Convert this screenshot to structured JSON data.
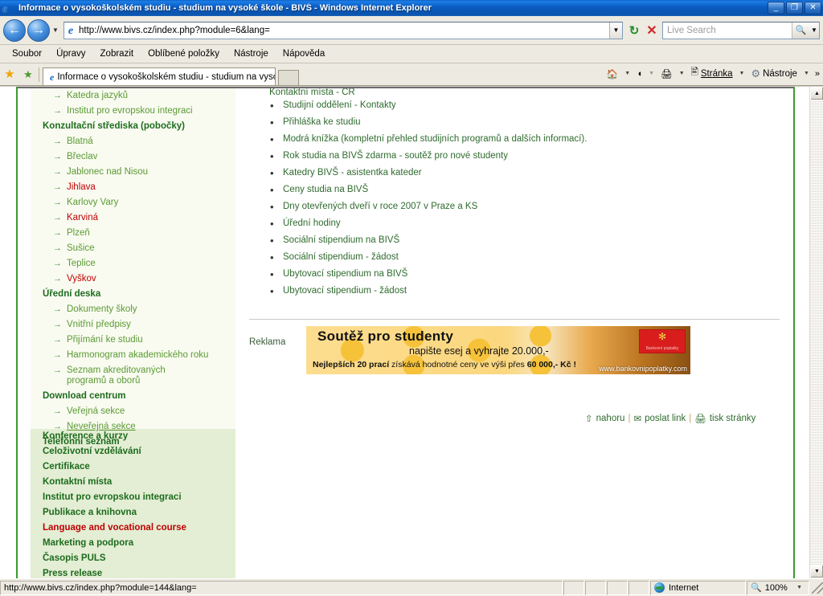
{
  "window": {
    "title": "Informace o vysokoškolském studiu - studium na vysoké škole - BIVŠ - Windows Internet Explorer",
    "minimize": "_",
    "restore": "❐",
    "close": "✕"
  },
  "toolbar": {
    "back_icon": "←",
    "forward_icon": "→",
    "history_caret": "▼",
    "url": "http://www.bivs.cz/index.php?module=6&lang=",
    "url_caret": "▼",
    "refresh_icon": "↻",
    "stop_icon": "✕",
    "search_placeholder": "Live Search",
    "search_icon": "🔍",
    "search_caret": "▼"
  },
  "menu": {
    "items": [
      {
        "label": "Soubor",
        "accel": "S"
      },
      {
        "label": "Úpravy",
        "accel": "r"
      },
      {
        "label": "Zobrazit",
        "accel": "Z"
      },
      {
        "label": "Oblíbené položky",
        "accel": "y"
      },
      {
        "label": "Nástroje",
        "accel": "t"
      },
      {
        "label": "Nápověda",
        "accel": "N"
      }
    ]
  },
  "tabbar": {
    "favorites_star": "★",
    "add_favorite": "★",
    "tab_title": "Informace o vysokoškolském studiu - studium na vyso...",
    "new_tab": "",
    "home_icon": "🏠",
    "feeds_icon": "◖",
    "print_icon": "🖨",
    "page_label": "Stránka",
    "page_accel": "S",
    "tools_label": "Nástroje",
    "tools_accel": "t",
    "tools_icon": "⚙",
    "overflow": "»",
    "caret": "▼"
  },
  "page": {
    "sidebar": {
      "top_items": [
        {
          "label": "Katedra jazyků",
          "type": "sub",
          "color": "green"
        },
        {
          "label": "Institut pro evropskou integraci",
          "type": "sub",
          "color": "green"
        },
        {
          "label": "Konzultační střediska (pobočky)",
          "type": "head"
        },
        {
          "label": "Blatná",
          "type": "sub",
          "color": "green"
        },
        {
          "label": "Břeclav",
          "type": "sub",
          "color": "green"
        },
        {
          "label": "Jablonec nad Nisou",
          "type": "sub",
          "color": "green"
        },
        {
          "label": "Jihlava",
          "type": "sub",
          "color": "red"
        },
        {
          "label": "Karlovy Vary",
          "type": "sub",
          "color": "green"
        },
        {
          "label": "Karviná",
          "type": "sub",
          "color": "red"
        },
        {
          "label": "Plzeň",
          "type": "sub",
          "color": "green"
        },
        {
          "label": "Sušice",
          "type": "sub",
          "color": "green"
        },
        {
          "label": "Teplice",
          "type": "sub",
          "color": "green"
        },
        {
          "label": "Vyškov",
          "type": "sub",
          "color": "red"
        },
        {
          "label": "Úřední deska",
          "type": "head"
        },
        {
          "label": "Dokumenty školy",
          "type": "sub",
          "color": "green"
        },
        {
          "label": "Vnitřní předpisy",
          "type": "sub",
          "color": "green"
        },
        {
          "label": "Přijímání ke studiu",
          "type": "sub",
          "color": "green"
        },
        {
          "label": "Harmonogram akademického roku",
          "type": "sub",
          "color": "green"
        },
        {
          "label": "Seznam akreditovaných programů a oborů",
          "type": "sub",
          "color": "green",
          "wrap": true
        },
        {
          "label": "Download centrum",
          "type": "head"
        },
        {
          "label": "Veřejná sekce",
          "type": "sub",
          "color": "green"
        },
        {
          "label": "Neveřejná sekce",
          "type": "sub",
          "color": "green",
          "hover": true
        },
        {
          "label": "Telefonní seznam",
          "type": "head"
        }
      ],
      "lower_items": [
        {
          "label": "Konference a kurzy",
          "color": "green"
        },
        {
          "label": "Celoživotní vzdělávání",
          "color": "green"
        },
        {
          "label": "Certifikace",
          "color": "green"
        },
        {
          "label": "Kontaktní místa",
          "color": "green"
        },
        {
          "label": "Institut pro evropskou integraci",
          "color": "green"
        },
        {
          "label": "Publikace a knihovna",
          "color": "green"
        },
        {
          "label": "Language and vocational course",
          "color": "red"
        },
        {
          "label": "Marketing a podpora",
          "color": "green"
        },
        {
          "label": "Časopis PULS",
          "color": "green"
        },
        {
          "label": "Press release",
          "color": "green"
        }
      ],
      "arrow_icon": "→"
    },
    "content": {
      "cut_off_line": "Kontaktní místa - ČR",
      "bullets": [
        "Studijní oddělení - Kontakty",
        "Přihláška ke studiu",
        "Modrá knížka (kompletní přehled studijních programů a dalších informací).",
        "Rok studia na BIVŠ zdarma - soutěž pro nové studenty",
        "Katedry BIVŠ - asistentka kateder",
        "Ceny studia na BIVŠ",
        "Dny otevřených dveří v roce 2007 v Praze a KS",
        "Úřední hodiny",
        "Sociální stipendium na BIVŠ",
        "Sociální stipendium - žádost",
        "Ubytovací stipendium na BIVŠ",
        "Ubytovací stipendium - žádost"
      ],
      "ad": {
        "label": "Reklama",
        "title": "Soutěž pro studenty",
        "subtitle": "napište esej a vyhrajte 20.000,-",
        "footer_bold_1": "Nejlepších 20 prací",
        "footer_light": " získává hodnotné ceny ve výši přes ",
        "footer_bold_2": "60 000,- Kč !",
        "url": "www.bankovnipoplatky.com",
        "logo_mark": "✻",
        "logo_text": "Bankovní poplatky"
      },
      "footer": {
        "top_icon": "⇧",
        "top_label": "nahoru",
        "mail_icon": "✉",
        "mail_label": "poslat link",
        "print_icon": "🖨",
        "print_label": "tisk stránky",
        "separator": "|"
      }
    },
    "scrollbar": {
      "up_arrow": "▲",
      "down_arrow": "▼"
    }
  },
  "statusbar": {
    "url": "http://www.bivs.cz/index.php?module=144&lang=",
    "zone": "Internet",
    "zoom": "100%",
    "zoom_icon": "🔍",
    "zoom_caret": "▼"
  }
}
